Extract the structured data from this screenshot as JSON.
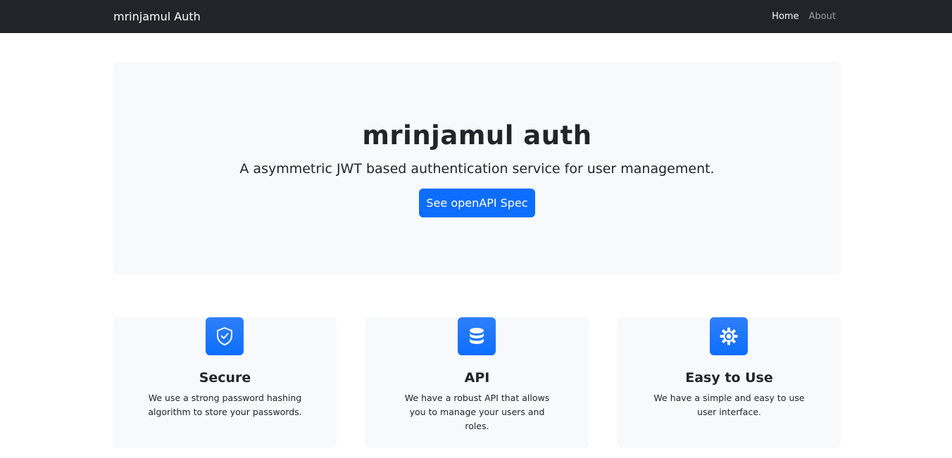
{
  "navbar": {
    "brand": "mrinjamul Auth",
    "links": [
      {
        "label": "Home"
      },
      {
        "label": "About"
      }
    ]
  },
  "hero": {
    "title": "mrinjamul auth",
    "lead": "A asymmetric JWT based authentication service for user management.",
    "button_label": "See openAPI Spec"
  },
  "features": [
    {
      "icon": "shield-check-icon",
      "title": "Secure",
      "text": "We use a strong password hashing algorithm to store your passwords."
    },
    {
      "icon": "database-icon",
      "title": "API",
      "text": "We have a robust API that allows you to manage your users and roles."
    },
    {
      "icon": "gear-icon",
      "title": "Easy to Use",
      "text": "We have a simple and easy to use user interface."
    }
  ],
  "colors": {
    "navbar_bg": "#212529",
    "primary": "#0d6efd",
    "panel_bg": "#f8f9fa"
  }
}
